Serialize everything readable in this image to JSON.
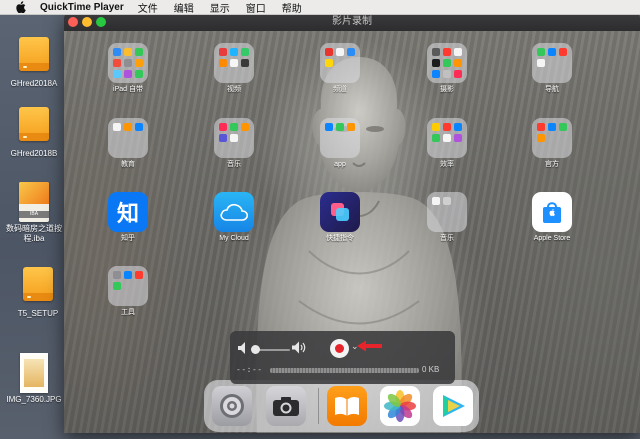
{
  "menubar": {
    "apple_icon": "apple-logo-icon",
    "app_name": "QuickTime Player",
    "menus": [
      "文件",
      "编辑",
      "显示",
      "窗口",
      "帮助"
    ]
  },
  "desktop": {
    "items": [
      {
        "label": "GHred2018A",
        "icon": "external-drive-icon"
      },
      {
        "label": "GHred2018B",
        "icon": "external-drive-icon"
      },
      {
        "label_line1": "数码暗房之道按",
        "label_line2": "程.iba",
        "icon": "ibooks-author-document-icon",
        "tag": "IBA"
      },
      {
        "label": "T5_SETUP",
        "icon": "external-drive-icon"
      },
      {
        "label": "IMG_7360.JPG",
        "icon": "photo-file-icon"
      }
    ]
  },
  "window": {
    "title": "影片录制",
    "traffic_lights": {
      "close": "#fe5f57",
      "minimize": "#febc2e",
      "zoom": "#28c840"
    }
  },
  "ipad": {
    "apps_row1": [
      "iPad 自带",
      "视频",
      "频道",
      "摄影",
      "导航"
    ],
    "apps_row2": [
      "教育",
      "音乐",
      "app",
      "效率",
      "官方"
    ],
    "apps_row3": [
      "知乎",
      "My Cloud",
      "快捷指令",
      "音乐",
      "Apple Store"
    ],
    "apps_row4": [
      "工具"
    ],
    "zhihu_glyph": "知",
    "dock": [
      "settings-icon",
      "camera-icon",
      "books-icon",
      "photos-icon",
      "infuse-icon"
    ]
  },
  "recording_hud": {
    "time": "--:--",
    "size": "0 KB",
    "volume_level": 0.0,
    "accent": "#e7232b"
  }
}
